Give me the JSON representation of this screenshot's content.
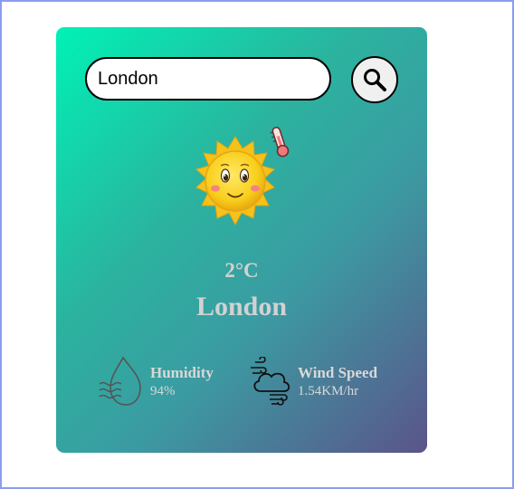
{
  "search": {
    "value": "London",
    "icon": "search-icon"
  },
  "weather": {
    "icon": "sun-thermometer-icon",
    "temperature": "2°C",
    "city": "London"
  },
  "details": {
    "humidity": {
      "icon": "humidity-drop-icon",
      "label": "Humidity",
      "value": "94%"
    },
    "wind": {
      "icon": "wind-cloud-icon",
      "label": "Wind Speed",
      "value": "1.54KM/hr"
    }
  },
  "colors": {
    "card_gradient_start": "#00f2b6",
    "card_gradient_end": "#5b548a",
    "text": "#d2d2d2",
    "sun": "#f7c51e"
  }
}
